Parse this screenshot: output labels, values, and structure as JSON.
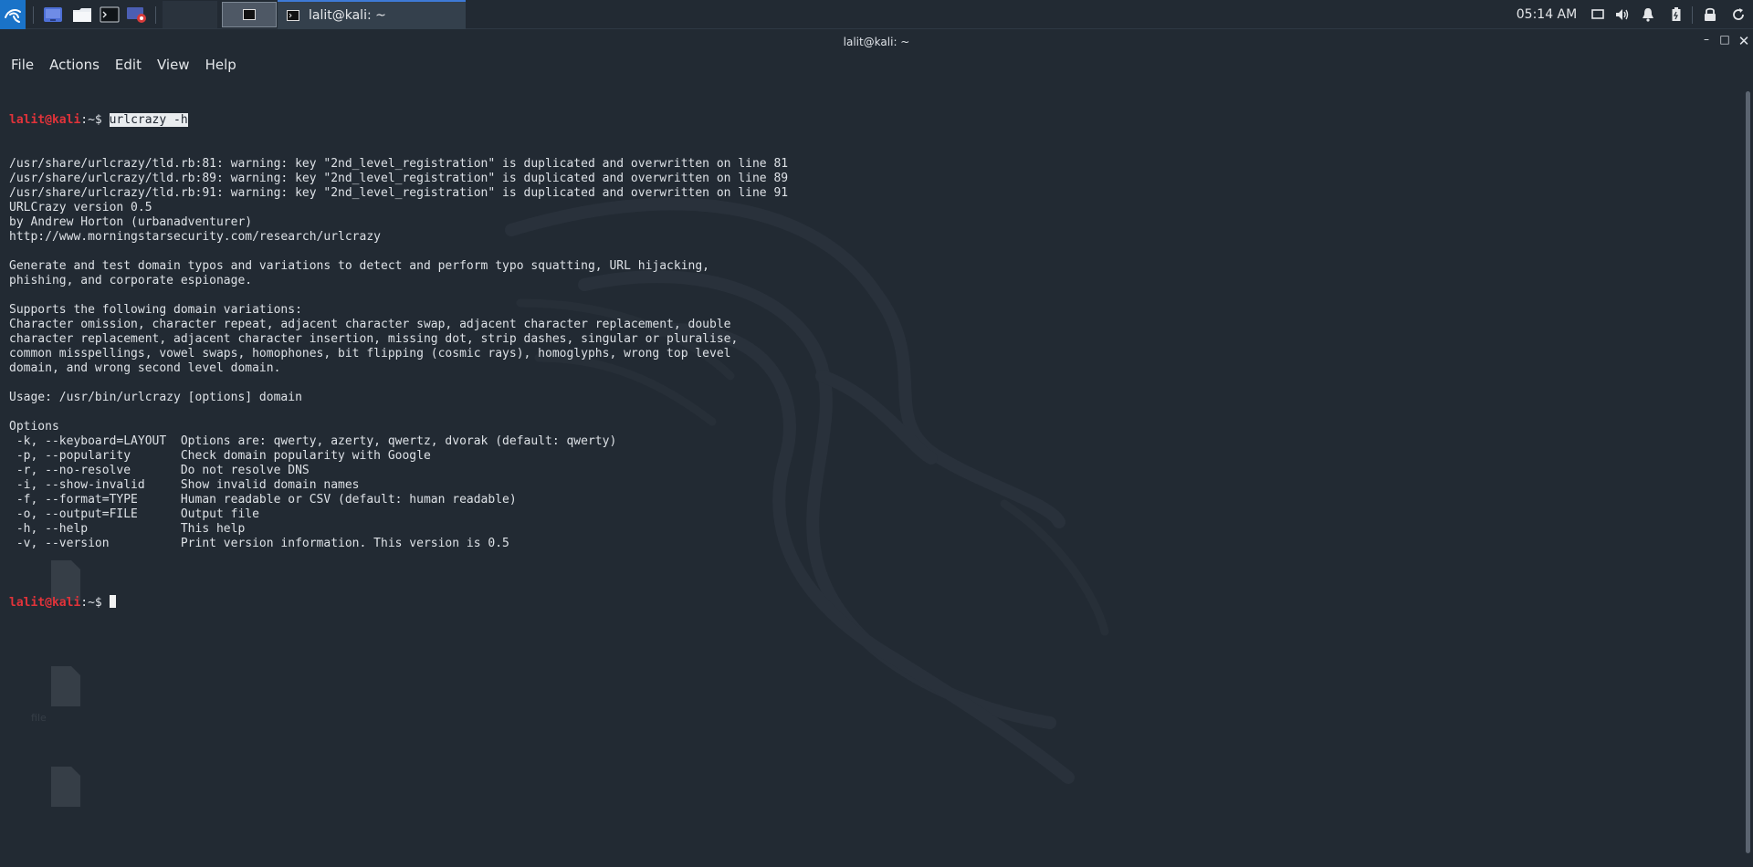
{
  "taskbar": {
    "task_title": "lalit@kali: ~",
    "clock": "05:14 AM"
  },
  "window": {
    "title": "lalit@kali: ~",
    "min_glyph": "–",
    "max_glyph": "□",
    "close_glyph": "✕"
  },
  "menu": {
    "file": "File",
    "actions": "Actions",
    "edit": "Edit",
    "view": "View",
    "help": "Help"
  },
  "terminal": {
    "prompt_user": "lalit@kali",
    "prompt_path": ":~$ ",
    "command": "urlcrazy -h",
    "output": [
      "/usr/share/urlcrazy/tld.rb:81: warning: key \"2nd_level_registration\" is duplicated and overwritten on line 81",
      "/usr/share/urlcrazy/tld.rb:89: warning: key \"2nd_level_registration\" is duplicated and overwritten on line 89",
      "/usr/share/urlcrazy/tld.rb:91: warning: key \"2nd_level_registration\" is duplicated and overwritten on line 91",
      "URLCrazy version 0.5",
      "by Andrew Horton (urbanadventurer)",
      "http://www.morningstarsecurity.com/research/urlcrazy",
      "",
      "Generate and test domain typos and variations to detect and perform typo squatting, URL hijacking,",
      "phishing, and corporate espionage.",
      "",
      "Supports the following domain variations:",
      "Character omission, character repeat, adjacent character swap, adjacent character replacement, double",
      "character replacement, adjacent character insertion, missing dot, strip dashes, singular or pluralise,",
      "common misspellings, vowel swaps, homophones, bit flipping (cosmic rays), homoglyphs, wrong top level",
      "domain, and wrong second level domain.",
      "",
      "Usage: /usr/bin/urlcrazy [options] domain",
      "",
      "Options",
      " -k, --keyboard=LAYOUT  Options are: qwerty, azerty, qwertz, dvorak (default: qwerty)",
      " -p, --popularity       Check domain popularity with Google",
      " -r, --no-resolve       Do not resolve DNS",
      " -i, --show-invalid     Show invalid domain names",
      " -f, --format=TYPE      Human readable or CSV (default: human readable)",
      " -o, --output=FILE      Output file",
      " -h, --help             This help",
      " -v, --version          Print version information. This version is 0.5",
      ""
    ]
  }
}
